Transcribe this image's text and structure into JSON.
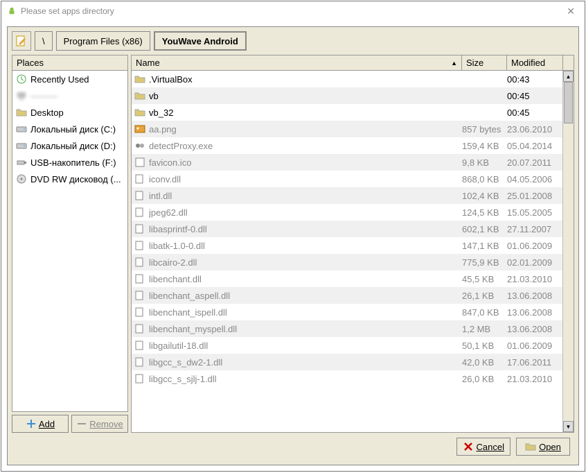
{
  "window": {
    "title": "Please set apps directory"
  },
  "breadcrumb": {
    "root": "\\",
    "seg1": "Program Files (x86)",
    "seg2": "YouWave Android"
  },
  "places": {
    "header": "Places",
    "items": [
      {
        "label": "Recently Used",
        "icon": "clock"
      },
      {
        "label": "———",
        "icon": "pc",
        "blurred": true
      },
      {
        "label": "Desktop",
        "icon": "folder"
      },
      {
        "label": "Локальный диск (C:)",
        "icon": "disk"
      },
      {
        "label": "Локальный диск (D:)",
        "icon": "disk"
      },
      {
        "label": "USB-накопитель (F:)",
        "icon": "usb"
      },
      {
        "label": "DVD RW дисковод (...",
        "icon": "dvd"
      }
    ],
    "add_label": "Add",
    "remove_label": "Remove"
  },
  "columns": {
    "name": "Name",
    "size": "Size",
    "modified": "Modified"
  },
  "files": [
    {
      "name": ".VirtualBox",
      "size": "",
      "modified": "00:43",
      "type": "folder",
      "dim": false
    },
    {
      "name": "vb",
      "size": "",
      "modified": "00:45",
      "type": "folder",
      "dim": false
    },
    {
      "name": "vb_32",
      "size": "",
      "modified": "00:45",
      "type": "folder",
      "dim": false
    },
    {
      "name": "aa.png",
      "size": "857 bytes",
      "modified": "23.06.2010",
      "type": "img",
      "dim": true
    },
    {
      "name": "detectProxy.exe",
      "size": "159,4 KB",
      "modified": "05.04.2014",
      "type": "exe",
      "dim": true
    },
    {
      "name": "favicon.ico",
      "size": "9,8 KB",
      "modified": "20.07.2011",
      "type": "ico",
      "dim": true
    },
    {
      "name": "iconv.dll",
      "size": "868,0 KB",
      "modified": "04.05.2006",
      "type": "dll",
      "dim": true
    },
    {
      "name": "intl.dll",
      "size": "102,4 KB",
      "modified": "25.01.2008",
      "type": "dll",
      "dim": true
    },
    {
      "name": "jpeg62.dll",
      "size": "124,5 KB",
      "modified": "15.05.2005",
      "type": "dll",
      "dim": true
    },
    {
      "name": "libasprintf-0.dll",
      "size": "602,1 KB",
      "modified": "27.11.2007",
      "type": "dll",
      "dim": true
    },
    {
      "name": "libatk-1.0-0.dll",
      "size": "147,1 KB",
      "modified": "01.06.2009",
      "type": "dll",
      "dim": true
    },
    {
      "name": "libcairo-2.dll",
      "size": "775,9 KB",
      "modified": "02.01.2009",
      "type": "dll",
      "dim": true
    },
    {
      "name": "libenchant.dll",
      "size": "45,5 KB",
      "modified": "21.03.2010",
      "type": "dll",
      "dim": true
    },
    {
      "name": "libenchant_aspell.dll",
      "size": "26,1 KB",
      "modified": "13.06.2008",
      "type": "dll",
      "dim": true
    },
    {
      "name": "libenchant_ispell.dll",
      "size": "847,0 KB",
      "modified": "13.06.2008",
      "type": "dll",
      "dim": true
    },
    {
      "name": "libenchant_myspell.dll",
      "size": "1,2 MB",
      "modified": "13.06.2008",
      "type": "dll",
      "dim": true
    },
    {
      "name": "libgailutil-18.dll",
      "size": "50,1 KB",
      "modified": "01.06.2009",
      "type": "dll",
      "dim": true
    },
    {
      "name": "libgcc_s_dw2-1.dll",
      "size": "42,0 KB",
      "modified": "17.06.2011",
      "type": "dll",
      "dim": true
    },
    {
      "name": "libgcc_s_sjlj-1.dll",
      "size": "26,0 KB",
      "modified": "21.03.2010",
      "type": "dll",
      "dim": true
    }
  ],
  "buttons": {
    "cancel": "Cancel",
    "open": "Open"
  }
}
